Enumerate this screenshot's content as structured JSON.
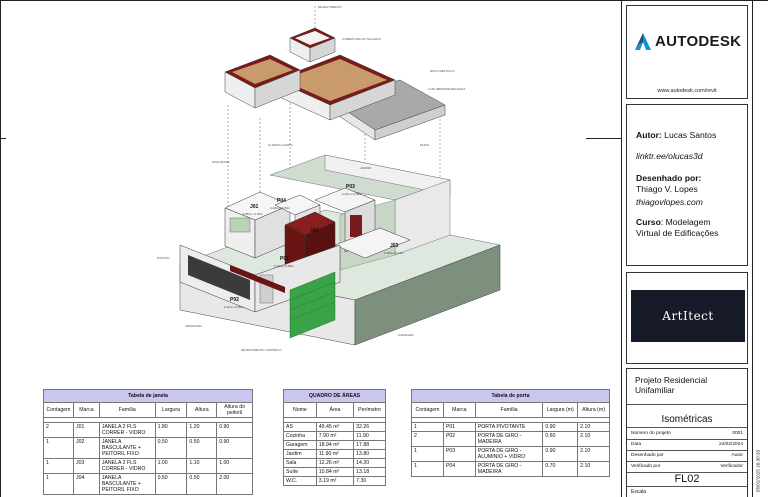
{
  "drawing": {
    "leader_tags": [
      "REVESTIMENTO",
      "COBERTURA DO TELHADO",
      "RUFO METÁLICO",
      "LAJE IMPERMEABILIZADA",
      "ESQUADRIA",
      "GUARDA-CORPO",
      "JARDIM",
      "MURO",
      "ARMADURA",
      "GARAGEM",
      "PORTÃO",
      "REVESTIMENTO CERÂMICO"
    ],
    "rooms": [
      {
        "tag": "J01",
        "sub": "1.80m x 1.20m"
      },
      {
        "tag": "P04",
        "sub": "2.10m x 0.70m"
      },
      {
        "tag": "P03",
        "sub": "2.10m x 0.90m"
      },
      {
        "tag": "J04",
        "sub": "0.50m x 0.50m"
      },
      {
        "tag": "J03",
        "sub": "1.00m x 1.10m"
      },
      {
        "tag": "P01",
        "sub": "2.10m x 0.90m"
      },
      {
        "tag": "P02",
        "sub": "2.10m x 0.60m"
      }
    ]
  },
  "window_table": {
    "title": "Tabela de janela",
    "headers": [
      "Contagem",
      "Marca",
      "Família",
      "Largura",
      "Altura",
      "Altura do peitoril"
    ],
    "rows": [
      [
        "2",
        "J01",
        "JANELA 2 FLS CORRER - VIDRO",
        "1.80",
        "1.20",
        "0.90"
      ],
      [
        "1",
        "J02",
        "JANELA BASCULANTE + PEITORIL FIXO",
        "0.50",
        "0.50",
        "0.90"
      ],
      [
        "1",
        "J03",
        "JANELA 2 FLS CORRER - VIDRO",
        "1.00",
        "1.10",
        "1.00"
      ],
      [
        "1",
        "J04",
        "JANELA BASCULANTE + PEITORIL FIXO",
        "0.50",
        "0.50",
        "2.00"
      ]
    ]
  },
  "area_table": {
    "title": "QUADRO DE ÁREAS",
    "headers": [
      "Nome",
      "Área",
      "Perímetro"
    ],
    "rows": [
      [
        "AS",
        "49.45 m²",
        "32.26"
      ],
      [
        "Cozinha",
        "7.90 m²",
        "11.90"
      ],
      [
        "Garagem",
        "18.94 m²",
        "17.88"
      ],
      [
        "Jardim",
        "11.90 m²",
        "13.80"
      ],
      [
        "Sala",
        "12.26 m²",
        "14.20"
      ],
      [
        "Suíte",
        "10.84 m²",
        "13.18"
      ],
      [
        "W.C.",
        "3.19 m²",
        "7.30"
      ]
    ]
  },
  "door_table": {
    "title": "Tabela de porta",
    "headers": [
      "Contagem",
      "Marca",
      "Família",
      "Largura (m)",
      "Altura (m)"
    ],
    "rows": [
      [
        "1",
        "P01",
        "PORTA PIVOTANTE",
        "0.90",
        "2.10"
      ],
      [
        "2",
        "P02",
        "PORTA DE GIRO - MADEIRA",
        "0.60",
        "2.10"
      ],
      [
        "1",
        "P03",
        "PORTA DE GIRO - ALUMINIO + VIDRO",
        "0.90",
        "2.10"
      ],
      [
        "1",
        "P04",
        "PORTA DE GIRO - MADEIRA",
        "0.70",
        "2.10"
      ]
    ]
  },
  "title_block": {
    "logo_word": "AUTODESK",
    "logo_url": "www.autodesk.com/revit",
    "author_label": "Autor:",
    "author_name": "Lucas Santos",
    "author_link": "linktr.ee/olucas3d",
    "drawn_label": "Desenhado por:",
    "drawn_name": "Thiago V. Lopes",
    "drawn_link": "thiagovlopes.com",
    "course_label": "Curso",
    "course_name": ": Modelagem",
    "course_name2": "Virtual de Edificações",
    "brand": "ArtItect",
    "project_name": "Projeto Residencial Unifamiliar",
    "view_name": "Isométricas",
    "fields": [
      {
        "label": "Número do projeto",
        "value": "0001"
      },
      {
        "label": "Data",
        "value": "24/02/2024"
      },
      {
        "label": "Desenhado por",
        "value": "Autor"
      },
      {
        "label": "Verificado por",
        "value": "Verificador"
      }
    ],
    "sheet_number": "FL02",
    "scale_label": "Escala",
    "timestamp": "05/02/2025 16:30:33"
  },
  "colors": {
    "wall": "#f2f2f2",
    "wall_dark": "#d9d9d9",
    "maroon": "#6b1414",
    "roof_tile": "#c99a6b",
    "grass": "#c8d8c8",
    "green_door": "#3aa348",
    "header_purple": "#c9c6ef",
    "brand_bg": "#171a28"
  }
}
